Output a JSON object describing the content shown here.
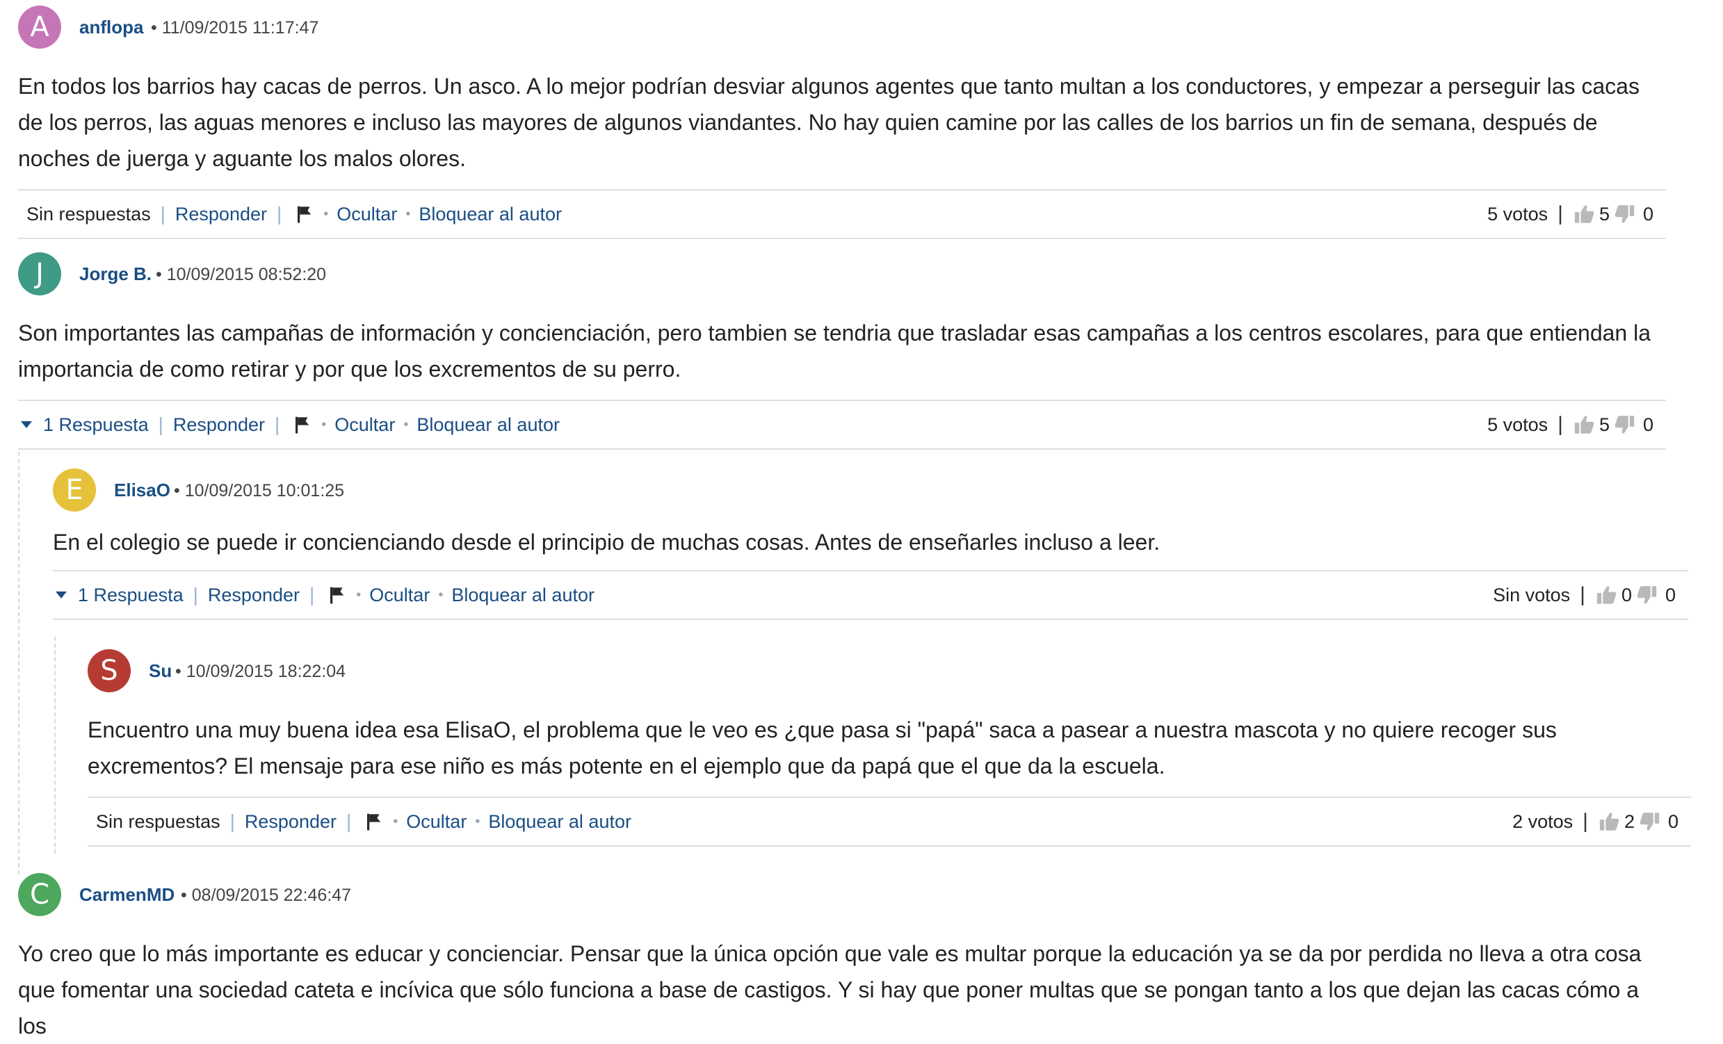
{
  "labels": {
    "reply": "Responder",
    "hide": "Ocultar",
    "block": "Bloquear al autor"
  },
  "icons": [
    "flag-icon",
    "thumbs-up-icon",
    "thumbs-down-icon",
    "caret-down-icon"
  ],
  "colors": {
    "link": "#1a4e84",
    "text": "#222222",
    "divider": "#dedede"
  },
  "comments": [
    {
      "avatar_letter": "A",
      "avatar_color": "#c676b7",
      "author": "anflopa",
      "meta": "• 11/09/2015 11:17:47",
      "text": "En todos los barrios hay cacas de perros. Un asco. A lo mejor podrían desviar algunos agentes que tanto multan a los conductores, y empezar a perseguir las cacas de los perros, las aguas menores e incluso las mayores de algunos viandantes. No hay quien camine por las calles de los barrios un fin de semana, después de noches de juerga y aguante los malos olores.",
      "replies_label": "Sin respuestas",
      "votes": "5 votos",
      "up": "5",
      "down": "0"
    },
    {
      "avatar_letter": "J",
      "avatar_color": "#3f9a86",
      "author": "Jorge B.",
      "meta": "• 10/09/2015 08:52:20",
      "text": "Son importantes las campañas de información y concienciación, pero tambien se tendria que trasladar esas campañas a los centros escolares, para que entiendan la importancia de como retirar y por que los excrementos de su perro.",
      "replies_label": "1 Respuesta",
      "votes": "5 votos",
      "up": "5",
      "down": "0"
    },
    {
      "avatar_letter": "E",
      "avatar_color": "#e5c239",
      "author": "ElisaO",
      "meta": "• 10/09/2015 10:01:25",
      "text": "En el colegio se puede ir concienciando desde el principio de muchas cosas. Antes de enseñarles incluso a leer.",
      "replies_label": "1 Respuesta",
      "votes": "Sin votos",
      "up": "0",
      "down": "0"
    },
    {
      "avatar_letter": "S",
      "avatar_color": "#b63b33",
      "author": "Su",
      "meta": "• 10/09/2015 18:22:04",
      "text": "Encuentro una muy buena idea esa ElisaO, el problema que le veo es ¿que pasa si \"papá\" saca a pasear a nuestra mascota y no quiere recoger sus excrementos? El mensaje para ese niño es más potente en el ejemplo que da papá que el que da la escuela.",
      "replies_label": "Sin respuestas",
      "votes": "2 votos",
      "up": "2",
      "down": "0"
    },
    {
      "avatar_letter": "C",
      "avatar_color": "#4da85e",
      "author": "CarmenMD",
      "meta": "• 08/09/2015 22:46:47",
      "text": "Yo creo que lo más importante es educar y concienciar. Pensar que la única opción que vale es multar porque la educación ya se da por perdida no lleva a otra cosa que fomentar una sociedad cateta e incívica que sólo funciona a base de castigos. Y si hay que poner multas que se pongan tanto a los que dejan las cacas cómo a los"
    }
  ]
}
